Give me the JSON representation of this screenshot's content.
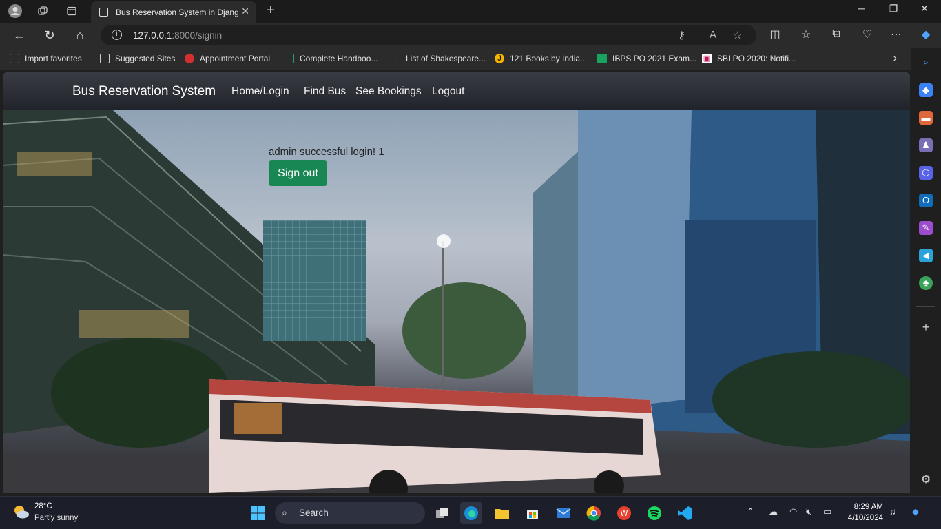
{
  "browser": {
    "tab_title": "Bus Reservation System in Djang",
    "url_host": "127.0.0.1",
    "url_rest": ":8000/signin",
    "favorites": [
      {
        "label": "Import favorites"
      },
      {
        "label": "Suggested Sites"
      },
      {
        "label": "Appointment Portal"
      },
      {
        "label": "Complete Handboo..."
      },
      {
        "label": "List of Shakespeare..."
      },
      {
        "label": "121 Books by India..."
      },
      {
        "label": "IBPS PO 2021 Exam..."
      },
      {
        "label": "SBI PO 2020: Notifi..."
      }
    ]
  },
  "site": {
    "brand": "Bus Reservation System",
    "nav": [
      "Home/Login",
      "Find Bus",
      "See Bookings",
      "Logout"
    ],
    "message": "admin successful login! 1",
    "signout_label": "Sign out",
    "accent": "#198754"
  },
  "taskbar": {
    "temperature": "28°C",
    "condition": "Partly sunny",
    "search_label": "Search",
    "time": "8:29 AM",
    "date": "4/10/2024"
  }
}
